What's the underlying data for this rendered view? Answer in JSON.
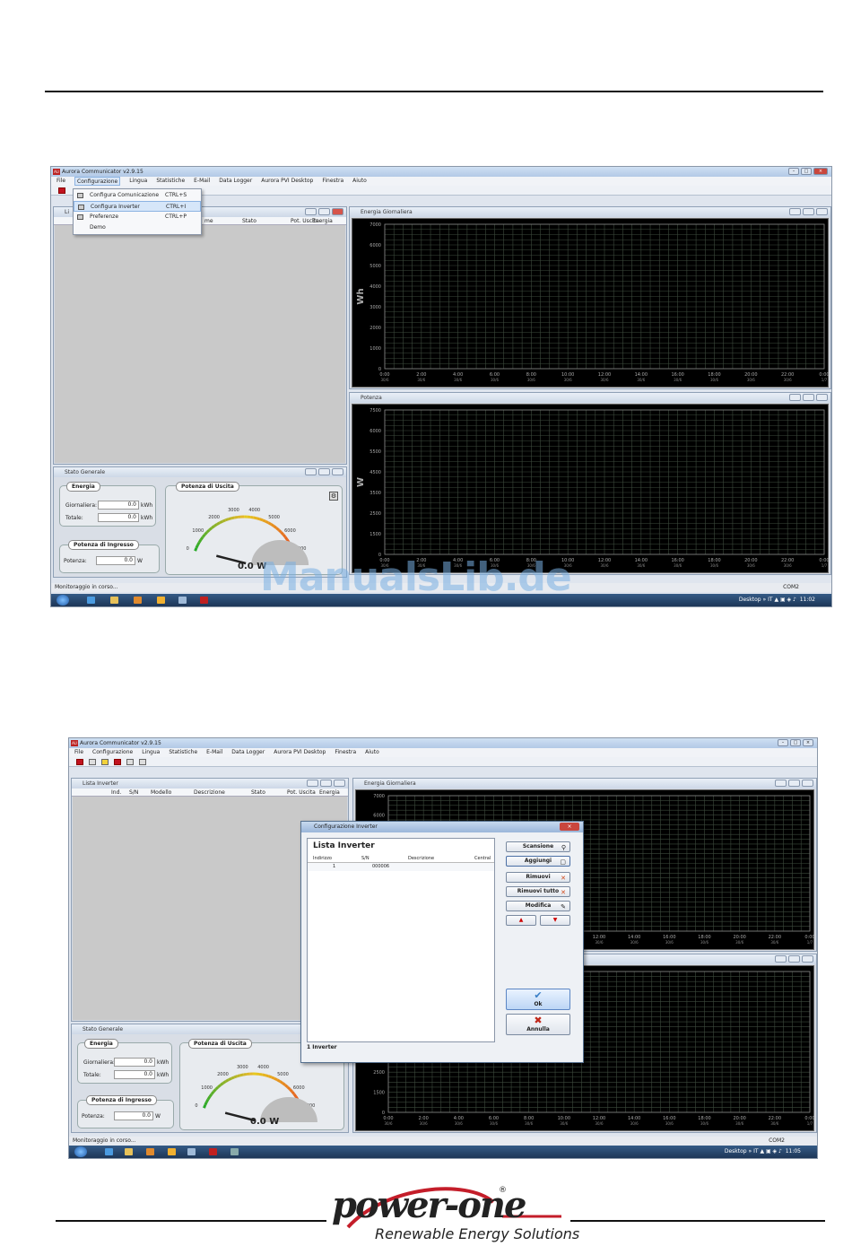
{
  "app": {
    "title": "Aurora Communicator v2.9.15",
    "menu": [
      "File",
      "Configurazione",
      "Lingua",
      "Statistiche",
      "E-Mail",
      "Data Logger",
      "Aurora PVI Desktop",
      "Finestra",
      "Aiuto"
    ]
  },
  "screen1": {
    "dropdown": [
      {
        "label": "Configura Comunicazione",
        "shortcut": "CTRL+S",
        "highlight": false
      },
      {
        "label": "Configura Inverter",
        "shortcut": "CTRL+I",
        "highlight": true
      },
      {
        "label": "Preferenze",
        "shortcut": "CTRL+P",
        "highlight": false
      },
      {
        "label": "Demo",
        "shortcut": "",
        "highlight": false
      }
    ],
    "list_panel_title_fragment": "Li",
    "list_columns": [
      "me",
      "Stato",
      "Pot. Uscita",
      "Energia"
    ],
    "status_text": "Monitoraggio in corso...",
    "clock": "11:02"
  },
  "screen2": {
    "list_panel_title": "Lista Inverter",
    "list_columns": [
      "Ind.",
      "S/N",
      "Modello",
      "Descrizione",
      "Stato",
      "Pot. Uscita",
      "Energia"
    ],
    "status_text": "Monitoraggio in corso...",
    "clock": "11:05",
    "dialog": {
      "title": "Configurazione Inverter",
      "heading": "Lista Inverter",
      "columns": [
        "Indirizzo",
        "S/N",
        "Descrizione",
        "Central"
      ],
      "rows": [
        {
          "indirizzo": "1",
          "sn": "000006",
          "descrizione": "",
          "central": ""
        }
      ],
      "footer": "1 Inverter",
      "buttons": {
        "scansione": "Scansione",
        "aggiungi": "Aggiungi",
        "rimuovi": "Rimuovi",
        "rimuovi_tutto": "Rimuovi tutto",
        "modifica": "Modifica",
        "ok": "Ok",
        "annulla": "Annulla"
      }
    }
  },
  "energia_chart": {
    "title": "Energia Giornaliera",
    "ylabel": "Wh",
    "yticks": [
      "7000",
      "6000",
      "5000",
      "4000",
      "3000",
      "2000",
      "1000",
      "0"
    ],
    "xticks": [
      "0:00",
      "2:00",
      "4:00",
      "6:00",
      "8:00",
      "10:00",
      "12:00",
      "14:00",
      "16:00",
      "18:00",
      "20:00",
      "22:00",
      "0:00"
    ],
    "xsub": [
      "30/6",
      "30/6",
      "30/6",
      "30/6",
      "30/6",
      "30/6",
      "30/6",
      "30/6",
      "30/6",
      "30/6",
      "30/6",
      "30/6",
      "1/7"
    ]
  },
  "potenza_chart": {
    "title": "Potenza",
    "ylabel": "W",
    "yticks": [
      "7500",
      "6000",
      "5500",
      "4500",
      "3500",
      "2500",
      "1500",
      "0"
    ]
  },
  "stato": {
    "title": "Stato Generale",
    "energia_label": "Energia",
    "giornaliera_label": "Giornaliera:",
    "giornaliera_value": "0.0",
    "totale_label": "Totale:",
    "totale_value": "0.0",
    "unit_kwh": "kWh",
    "ingresso_label": "Potenza di Ingresso",
    "potenza_label": "Potenza:",
    "potenza_value": "0.0",
    "unit_w": "W",
    "uscita_label": "Potenza di Uscita",
    "gauge_value": "0.0 W",
    "gauge_ticks": [
      "0",
      "1000",
      "2000",
      "3000",
      "4000",
      "5000",
      "6000",
      "7000"
    ]
  },
  "taskbar": {
    "desktop": "Desktop",
    "lang": "IT",
    "port": "COM2"
  },
  "watermark": "ManualsLib.de",
  "logo": {
    "main": "power-one",
    "reg": "®",
    "sub": "Renewable Energy Solutions"
  }
}
